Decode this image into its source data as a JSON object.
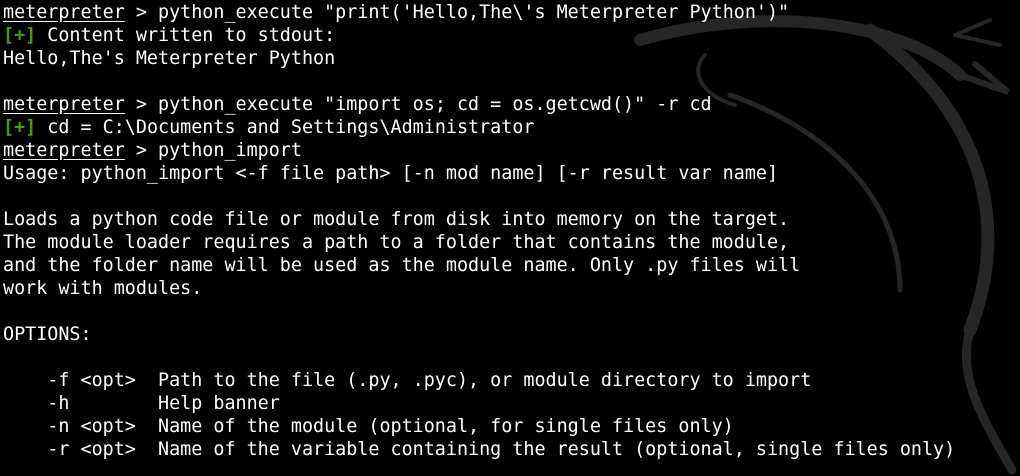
{
  "prompt": "meterpreter",
  "plus_marker": "[+]",
  "colors": {
    "background": "#000000",
    "text": "#ffffff",
    "success_marker": "#4e9a06",
    "watermark": "#262626"
  },
  "watermark_icon": "kali-dragon-icon",
  "lines": [
    {
      "type": "command",
      "text": " > python_execute \"print('Hello,The\\'s Meterpreter Python')\""
    },
    {
      "type": "status",
      "text": " Content written to stdout:"
    },
    {
      "type": "output",
      "text": "Hello,The's Meterpreter Python"
    },
    {
      "type": "blank",
      "text": ""
    },
    {
      "type": "command",
      "text": " > python_execute \"import os; cd = os.getcwd()\" -r cd"
    },
    {
      "type": "status",
      "text": " cd = C:\\Documents and Settings\\Administrator"
    },
    {
      "type": "command",
      "text": " > python_import"
    },
    {
      "type": "output",
      "text": "Usage: python_import <-f file path> [-n mod name] [-r result var name]"
    },
    {
      "type": "blank",
      "text": ""
    },
    {
      "type": "output",
      "text": "Loads a python code file or module from disk into memory on the target."
    },
    {
      "type": "output",
      "text": "The module loader requires a path to a folder that contains the module,"
    },
    {
      "type": "output",
      "text": "and the folder name will be used as the module name. Only .py files will"
    },
    {
      "type": "output",
      "text": "work with modules."
    },
    {
      "type": "blank",
      "text": ""
    },
    {
      "type": "output",
      "text": "OPTIONS:"
    },
    {
      "type": "blank",
      "text": ""
    },
    {
      "type": "output",
      "text": "    -f <opt>  Path to the file (.py, .pyc), or module directory to import"
    },
    {
      "type": "output",
      "text": "    -h        Help banner"
    },
    {
      "type": "output",
      "text": "    -n <opt>  Name of the module (optional, for single files only)"
    },
    {
      "type": "output",
      "text": "    -r <opt>  Name of the variable containing the result (optional, single files only)"
    }
  ]
}
